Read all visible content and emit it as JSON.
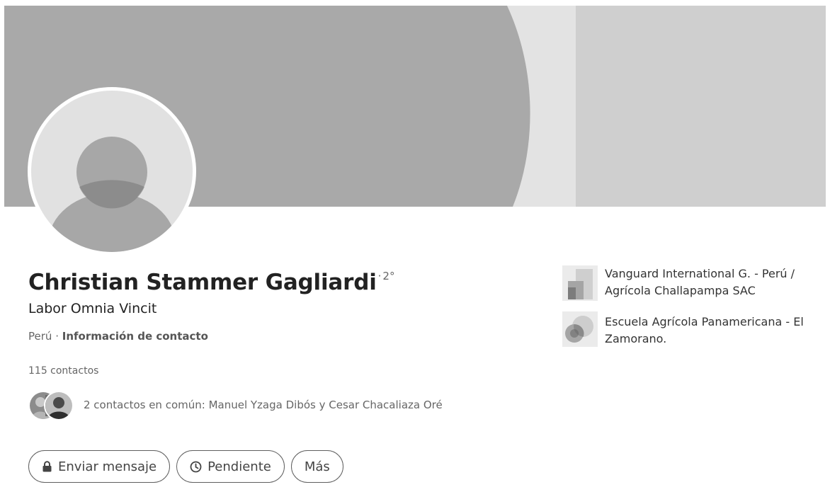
{
  "profile": {
    "name": "Christian Stammer Gagliardi",
    "degree_sep": "·",
    "degree": "2°",
    "headline": "Labor Omnia Vincit",
    "location": "Perú",
    "location_sep": " · ",
    "contact_info_link": "Información de contacto",
    "connections": "115 contactos",
    "mutual_connections": "2 contactos en común: Manuel Yzaga Dibós y Cesar Chacaliaza Oré"
  },
  "actions": {
    "message_label": "Enviar mensaje",
    "message_icon": "lock-icon",
    "pending_label": "Pendiente",
    "pending_icon": "clock-icon",
    "more_label": "Más"
  },
  "positions": {
    "experience_label": "Vanguard International G. - Perú / Agrícola Challapampa SAC",
    "education_label": "Escuela Agrícola Panamericana - El Zamorano."
  },
  "colors": {
    "cover_main": "#a9a9a9",
    "cover_stripe": "#e3e3e3",
    "cover_right": "#cfcfcf",
    "avatar_bg": "#e1e1e1",
    "avatar_figure": "#a7a7a7"
  }
}
